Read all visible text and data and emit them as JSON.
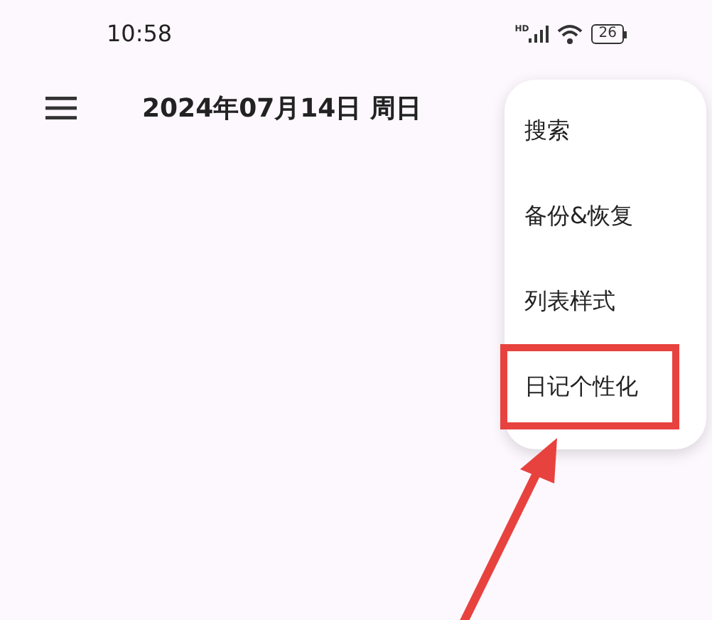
{
  "status_bar": {
    "time": "10:58",
    "signal_label": "HD",
    "battery": "26"
  },
  "app_bar": {
    "title": "2024年07月14日 周日"
  },
  "menu": {
    "items": [
      {
        "label": "搜索",
        "highlighted": false
      },
      {
        "label": "备份&恢复",
        "highlighted": false
      },
      {
        "label": "列表样式",
        "highlighted": false
      },
      {
        "label": "日记个性化",
        "highlighted": true
      }
    ]
  }
}
